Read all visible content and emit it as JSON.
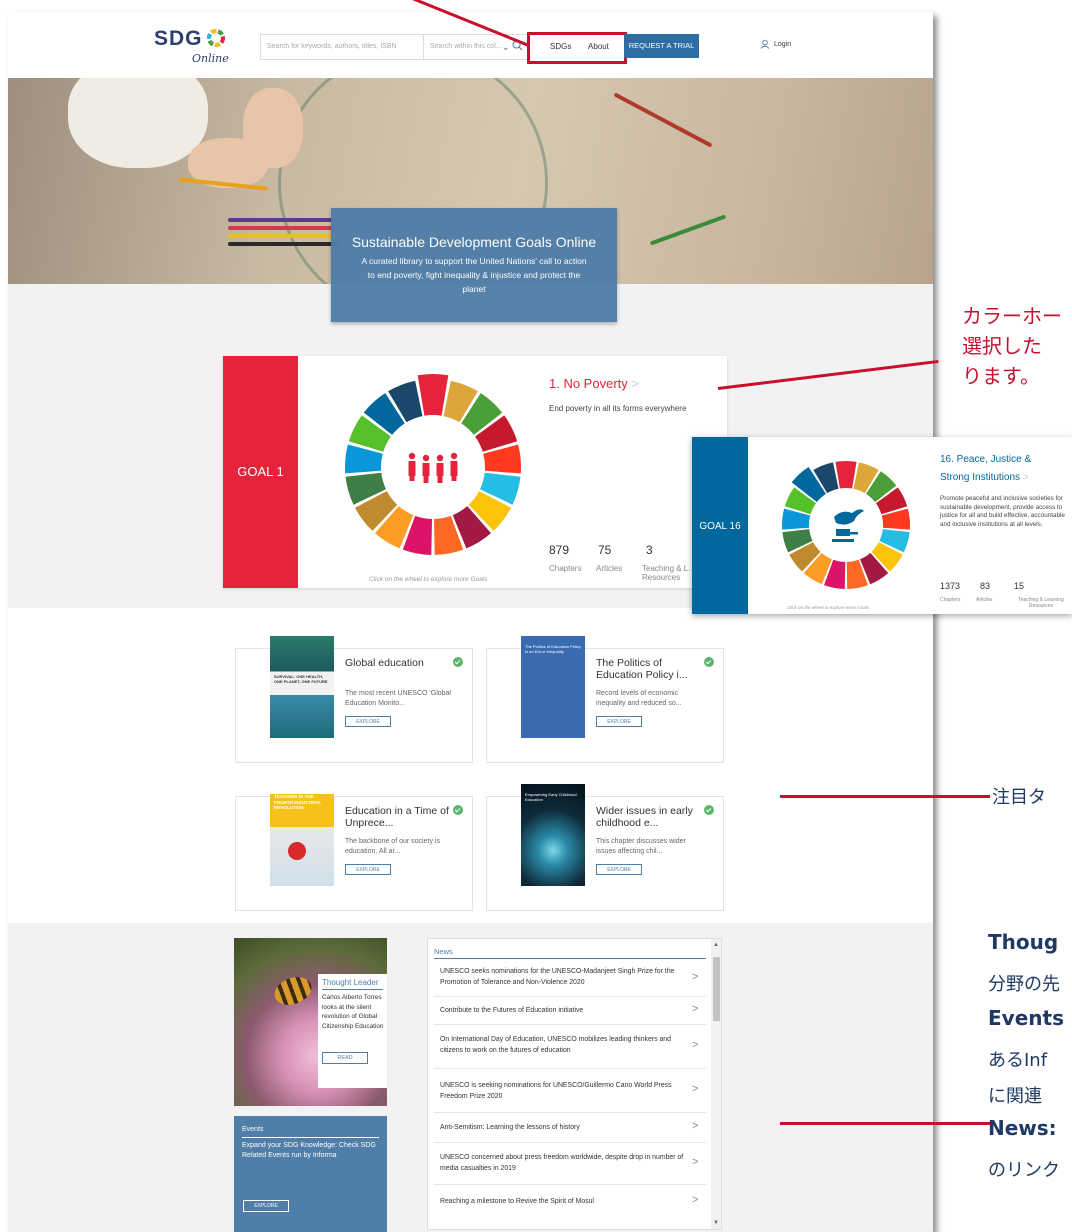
{
  "header": {
    "logo_text": "SDG",
    "logo_sub": "Online",
    "search_placeholder": "Search for keywords, authors, titles, ISBN",
    "search_scope": "Search within this col...",
    "nav": [
      "SDGs",
      "About"
    ],
    "trial_button": "REQUEST A TRIAL",
    "login": "Login"
  },
  "hero": {
    "title": "Sustainable Development Goals Online",
    "subtitle": "A curated library to support the United Nations' call to action to end poverty, fight inequality & injustice and protect the planet"
  },
  "goal_card": {
    "label": "GOAL 1",
    "title": "1. No Poverty",
    "arrow": ">",
    "description": "End poverty in all its forms everywhere",
    "stats": [
      {
        "value": "879",
        "label": "Chapters"
      },
      {
        "value": "75",
        "label": "Articles"
      },
      {
        "value": "3",
        "label": "Teaching & L… Resources"
      }
    ],
    "hint": "Click on the wheel to explore more Goals",
    "color": "#e5243b"
  },
  "goal16_card": {
    "label": "GOAL 16",
    "title": "16. Peace, Justice & Strong Institutions",
    "arrow": ">",
    "description": "Promote peaceful and inclusive societies for sustainable development, provide access to justice for all and build effective, accountable and inclusive institutions at all levels.",
    "stats": [
      {
        "value": "1373",
        "label": "Chapters"
      },
      {
        "value": "83",
        "label": "Articles"
      },
      {
        "value": "15",
        "label": "Teaching & Learning Resources"
      }
    ],
    "hint": "Click on the wheel to explore more Goals",
    "color": "#00689d"
  },
  "featured": [
    {
      "title": "Global education",
      "desc": "The most recent UNESCO 'Global Education Monito...",
      "button": "EXPLORE",
      "cover_text": "SURVIVAL: ONE HEALTH, ONE PLANET, ONE FUTURE"
    },
    {
      "title": "The Politics of Education Policy i...",
      "desc": "Record levels of economic inequality and reduced so...",
      "button": "EXPLORE",
      "cover_text": "The Politics of Education Policy in an Era of Inequality"
    },
    {
      "title": "Education in a Time of Unprece...",
      "desc": "The backbone of our society is education. All ar...",
      "button": "EXPLORE",
      "cover_text": "TEACHING IN THE FOURTH INDUSTRIAL REVOLUTION"
    },
    {
      "title": "Wider issues in early childhood e...",
      "desc": "This chapter discusses wider issues affecting chil...",
      "button": "EXPLORE",
      "cover_text": "Empowering Early Childhood Education"
    }
  ],
  "thought_leader": {
    "heading": "Thought Leader",
    "body": "Carlos Alberto Torres looks at the silent revolution of Global Citizenship Education",
    "button": "READ"
  },
  "events": {
    "heading": "Events",
    "body": "Expand your SDG Knowledge: Check SDG Related Events run by Informa",
    "button": "EXPLORE"
  },
  "news": {
    "heading": "News",
    "items": [
      "UNESCO seeks nominations for the UNESCO-Madanjeet Singh Prize for the Promotion of Tolerance and Non-Violence 2020",
      "Contribute to the Futures of Education initiative",
      "On International Day of Education, UNESCO mobilizes leading thinkers and citizens to work on the futures of education",
      "UNESCO is seeking nominations for UNESCO/Guillermo Cano World Press Freedom Prize 2020",
      "Anti-Semitism: Learning the lessons of history",
      "UNESCO concerned about press freedom worldwide, despite drop in number of media casualties in 2019",
      "Reaching a milestone to Revive the Spirit of Mosul"
    ],
    "arrow": ">"
  },
  "annotations": {
    "color_wheel": "カラーホー",
    "color_wheel_2": "選択した",
    "color_wheel_3": "ります。",
    "featured": "注目タ",
    "thought_label": "Thoug",
    "thought_desc": "分野の先",
    "events_label": "Events",
    "events_desc": "あるInf",
    "events_desc_2": "に関連",
    "news_label": "News:",
    "news_desc": "のリンク"
  },
  "colors": {
    "accent": "#c8102e",
    "brand_blue": "#4f7ea8",
    "trial_blue": "#2e6da4",
    "navy_text": "#1f3864"
  }
}
